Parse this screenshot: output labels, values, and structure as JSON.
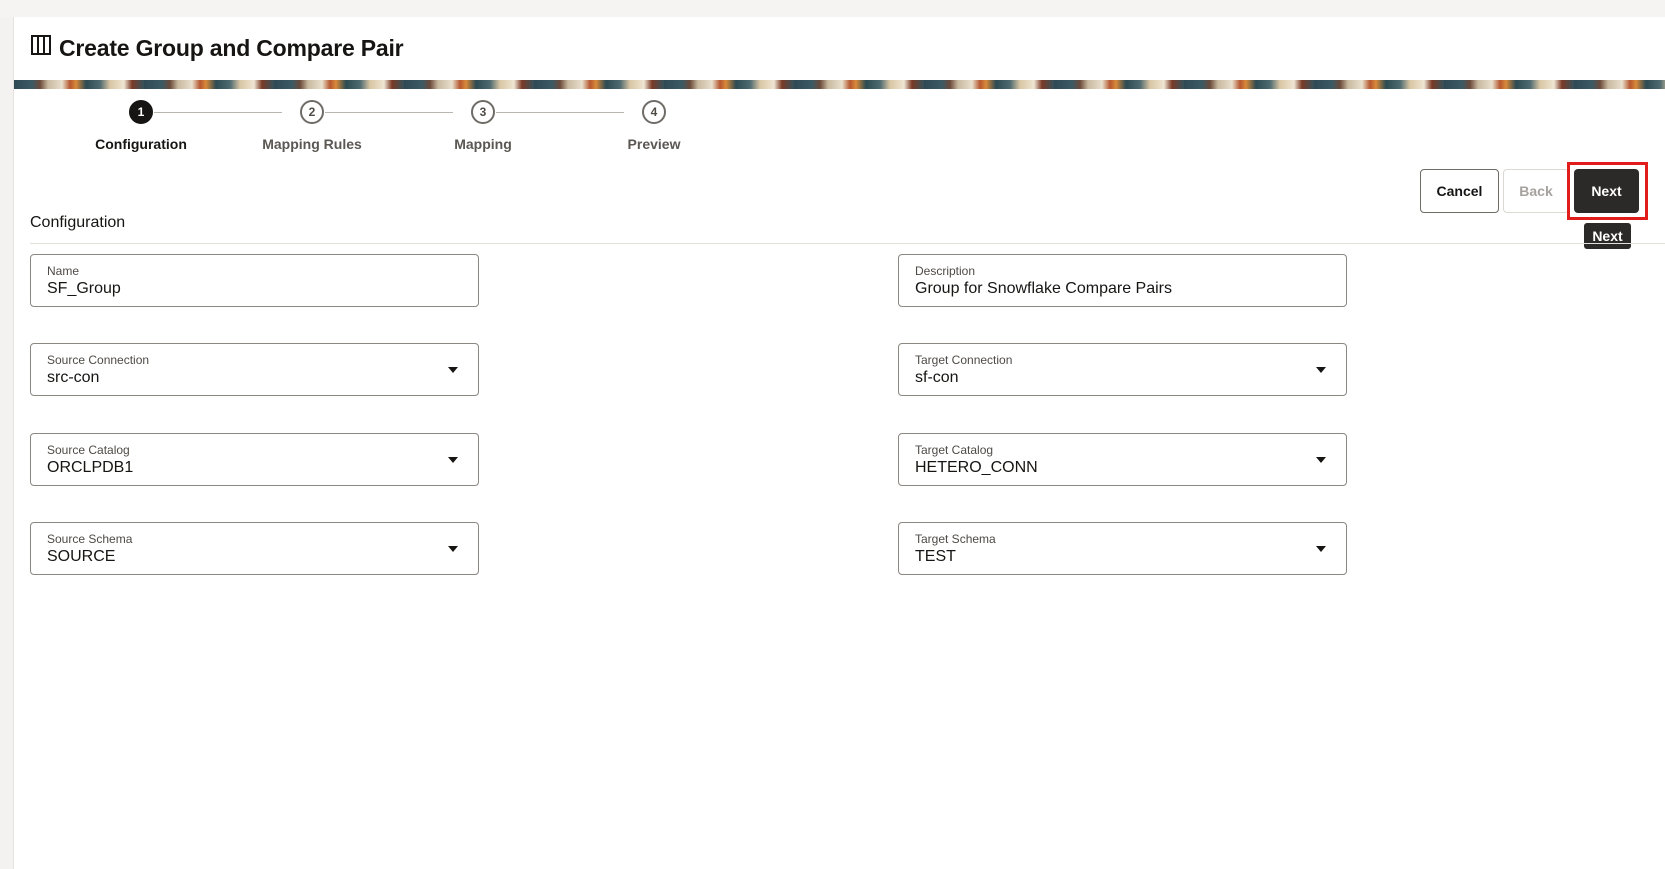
{
  "header": {
    "title": "Create Group and Compare Pair",
    "icon": "columns-icon"
  },
  "stepper": {
    "steps": [
      {
        "number": "1",
        "label": "Configuration",
        "active": true
      },
      {
        "number": "2",
        "label": "Mapping Rules",
        "active": false
      },
      {
        "number": "3",
        "label": "Mapping",
        "active": false
      },
      {
        "number": "4",
        "label": "Preview",
        "active": false
      }
    ]
  },
  "toolbar": {
    "cancel_label": "Cancel",
    "back_label": "Back",
    "next_label": "Next",
    "next_tooltip": "Next"
  },
  "section": {
    "title": "Configuration"
  },
  "form": {
    "name": {
      "label": "Name",
      "value": "SF_Group"
    },
    "description": {
      "label": "Description",
      "value": "Group for Snowflake Compare Pairs"
    },
    "source_connection": {
      "label": "Source Connection",
      "value": "src-con"
    },
    "target_connection": {
      "label": "Target Connection",
      "value": "sf-con"
    },
    "source_catalog": {
      "label": "Source Catalog",
      "value": "ORCLPDB1"
    },
    "target_catalog": {
      "label": "Target Catalog",
      "value": "HETERO_CONN"
    },
    "source_schema": {
      "label": "Source Schema",
      "value": "SOURCE"
    },
    "target_schema": {
      "label": "Target Schema",
      "value": "TEST"
    }
  },
  "colors": {
    "primary_button": "#2b2a28",
    "highlight": "#e21b1b",
    "text": "#161513"
  }
}
